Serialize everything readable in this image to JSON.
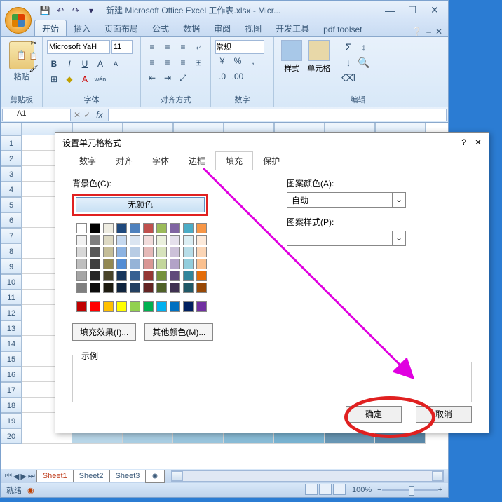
{
  "window": {
    "title": "新建 Microsoft Office Excel 工作表.xlsx - Micr...",
    "qat": {
      "save": "💾",
      "undo": "↶",
      "redo": "↷"
    },
    "sysmenu": {
      "min": "—",
      "max": "☐",
      "close": "✕"
    }
  },
  "ribbon": {
    "tabs": [
      "开始",
      "插入",
      "页面布局",
      "公式",
      "数据",
      "审阅",
      "视图",
      "开发工具",
      "pdf toolset"
    ],
    "help": "❔",
    "clipboard": {
      "paste": "粘贴",
      "label": "剪贴板",
      "cut": "✂",
      "copy": "📋",
      "fmt": "🖌"
    },
    "font": {
      "name": "Microsoft YaH",
      "size": "11",
      "bold": "B",
      "italic": "I",
      "underline": "U",
      "grow": "A",
      "shrink": "A",
      "border": "⊞",
      "fill": "◆",
      "fontcolor": "A",
      "pinyin": "wén",
      "label": "字体"
    },
    "align": {
      "label": "对齐方式"
    },
    "number": {
      "format": "常规",
      "label": "数字"
    },
    "styles": {
      "fmt": "样式",
      "cell": "单元格"
    },
    "editing": {
      "sum": "Σ",
      "fill": "↓",
      "clear": "⌫",
      "sort": "↕",
      "find": "🔍",
      "label": "编辑"
    }
  },
  "namebox": "A1",
  "fx": "fx",
  "sheets": {
    "s1": "Sheet1",
    "s2": "Sheet2",
    "s3": "Sheet3"
  },
  "status": {
    "ready": "就绪",
    "rec": "◉",
    "zoom": "100%"
  },
  "dialog": {
    "title": "设置单元格格式",
    "help": "?",
    "close": "✕",
    "tabs": [
      "数字",
      "对齐",
      "字体",
      "边框",
      "填充",
      "保护"
    ],
    "bgcolor_label": "背景色(C):",
    "nocolor": "无颜色",
    "pattern_color": "图案颜色(A):",
    "auto": "自动",
    "pattern_style": "图案样式(P):",
    "fill_effects": "填充效果(I)...",
    "more_colors": "其他颜色(M)...",
    "sample": "示例",
    "ok": "确定",
    "cancel": "取消",
    "palette": [
      [
        "#ffffff",
        "#000000",
        "#eeece1",
        "#1f497d",
        "#4f81bd",
        "#c0504d",
        "#9bbb59",
        "#8064a2",
        "#4bacc6",
        "#f79646"
      ],
      [
        "#f2f2f2",
        "#7f7f7f",
        "#ddd9c3",
        "#c6d9f0",
        "#dbe5f1",
        "#f2dcdb",
        "#ebf1dd",
        "#e5e0ec",
        "#dbeef3",
        "#fdeada"
      ],
      [
        "#d8d8d8",
        "#595959",
        "#c4bd97",
        "#8db3e2",
        "#b8cce4",
        "#e5b9b7",
        "#d7e3bc",
        "#ccc1d9",
        "#b7dde8",
        "#fbd5b5"
      ],
      [
        "#bfbfbf",
        "#3f3f3f",
        "#938953",
        "#548dd4",
        "#95b3d7",
        "#d99694",
        "#c3d69b",
        "#b2a2c7",
        "#92cddc",
        "#fac08f"
      ],
      [
        "#a5a5a5",
        "#262626",
        "#494429",
        "#17365d",
        "#366092",
        "#953734",
        "#76923c",
        "#5f497a",
        "#31859b",
        "#e36c09"
      ],
      [
        "#7f7f7f",
        "#0c0c0c",
        "#1d1b10",
        "#0f243e",
        "#244061",
        "#632423",
        "#4f6128",
        "#3f3151",
        "#205867",
        "#974806"
      ]
    ],
    "standard": [
      "#c00000",
      "#ff0000",
      "#ffc000",
      "#ffff00",
      "#92d050",
      "#00b050",
      "#00b0f0",
      "#0070c0",
      "#002060",
      "#7030a0"
    ]
  }
}
